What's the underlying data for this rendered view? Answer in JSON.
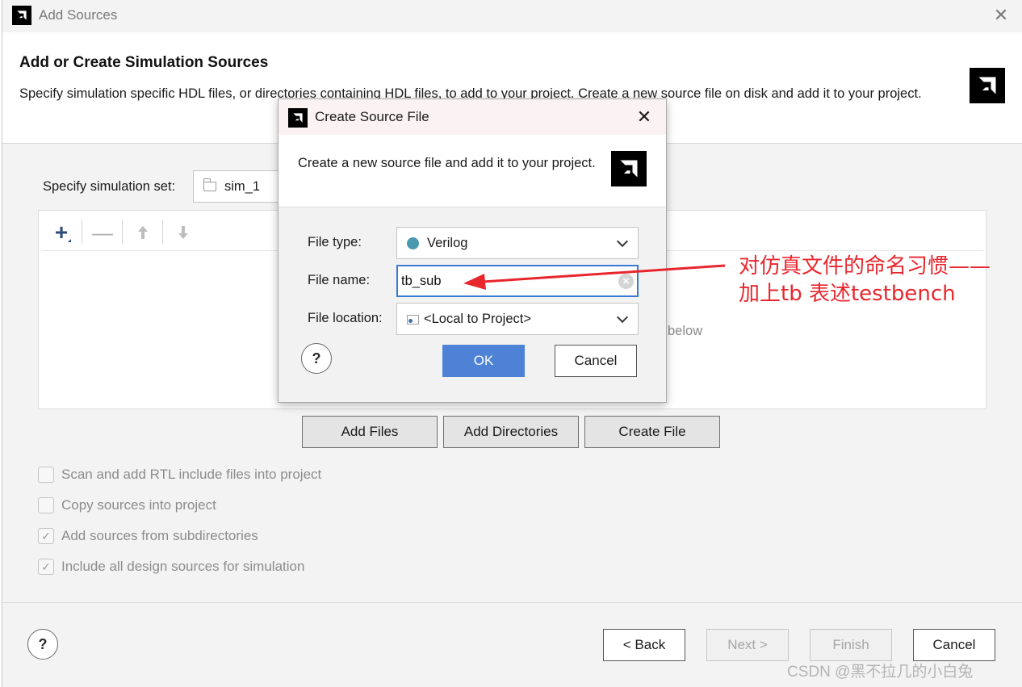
{
  "window": {
    "title": "Add Sources",
    "close_icon": "close-icon"
  },
  "header": {
    "title": "Add or Create Simulation Sources",
    "description": "Specify simulation specific HDL files, or directories containing HDL files, to add to your project. Create a new source file on disk and add it to your project."
  },
  "simulation_set": {
    "label": "Specify simulation set:",
    "value": "sim_1"
  },
  "sources_panel": {
    "toolbar": [
      "add-icon",
      "remove-icon",
      "move-up-icon",
      "move-down-icon"
    ],
    "hint_fragment": "below"
  },
  "actions": {
    "add_files": "Add Files",
    "add_directories": "Add Directories",
    "create_file": "Create File"
  },
  "options": [
    {
      "label": "Scan and add RTL include files into project",
      "checked": false
    },
    {
      "label": "Copy sources into project",
      "checked": false
    },
    {
      "label": "Add sources from subdirectories",
      "checked": true
    },
    {
      "label": "Include all design sources for simulation",
      "checked": true
    }
  ],
  "footer": {
    "help": "?",
    "back": "< Back",
    "next": "Next >",
    "finish": "Finish",
    "cancel": "Cancel"
  },
  "dialog": {
    "title": "Create Source File",
    "description": "Create a new source file and add it to your project.",
    "file_type": {
      "label": "File type:",
      "value": "Verilog",
      "dot_color": "#4a98b0"
    },
    "file_name": {
      "label": "File name:",
      "value": "tb_sub"
    },
    "file_location": {
      "label": "File location:",
      "value": "<Local to Project>"
    },
    "help": "?",
    "ok": "OK",
    "cancel": "Cancel"
  },
  "annotation": {
    "line1": "对仿真文件的命名习惯——",
    "line2": "加上tb 表述testbench",
    "color": "#e8262e"
  },
  "watermark": "CSDN @黑不拉几的小白兔",
  "colors": {
    "accent": "#4d82d6",
    "focus_border": "#3a7ad5",
    "annotation": "#e8262e"
  }
}
